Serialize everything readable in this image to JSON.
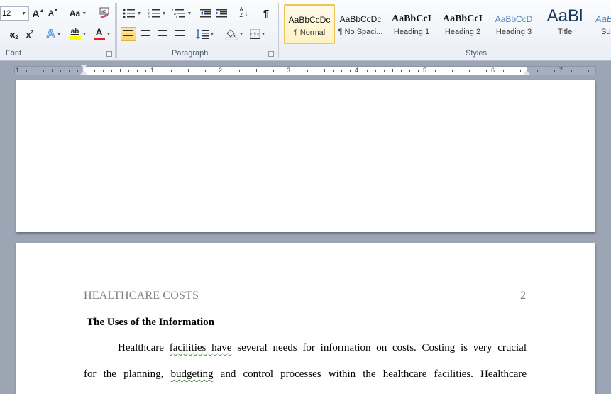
{
  "ribbon": {
    "font_group": {
      "label": "Font",
      "font_size": "12",
      "grow_font": "A",
      "shrink_font": "A",
      "change_case": "Aa",
      "subscript": "x",
      "subscript_mark": "2",
      "superscript": "x",
      "superscript_mark": "2",
      "text_effects": "A",
      "highlight": "ab",
      "font_color": "A",
      "highlight_color": "#ffff00",
      "font_color_value": "#e52020"
    },
    "paragraph_group": {
      "label": "Paragraph",
      "pilcrow": "¶",
      "sort": "A Z"
    },
    "styles_group": {
      "label": "Styles",
      "items": [
        {
          "preview": "AaBbCcDc",
          "label": "¶ Normal"
        },
        {
          "preview": "AaBbCcDc",
          "label": "¶ No Spaci..."
        },
        {
          "preview": "AaBbCcI",
          "label": "Heading 1"
        },
        {
          "preview": "AaBbCcI",
          "label": "Heading 2"
        },
        {
          "preview": "AaBbCcD",
          "label": "Heading 3"
        },
        {
          "preview": "AaBl",
          "label": "Title"
        },
        {
          "preview": "AaBb",
          "label": "Su"
        }
      ]
    }
  },
  "ruler": {
    "numbers": [
      "1",
      "1",
      "2",
      "3",
      "4",
      "5",
      "6",
      "7"
    ]
  },
  "document": {
    "page2": {
      "header": "HEALTHCARE COSTS",
      "page_number": "2",
      "heading": "The Uses of the Information",
      "line1": {
        "a": "Healthcare ",
        "b": "facilities  have",
        "c": " several needs for information on costs.  Costing is very crucial"
      },
      "line2": {
        "a": "for the planning, ",
        "b": " budgeting",
        "c": " and control processes within the healthcare facilities. Healthcare"
      }
    }
  }
}
